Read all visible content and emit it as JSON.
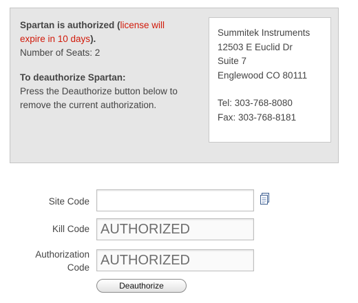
{
  "status": {
    "authorized_text": "Spartan is authorized (",
    "warning_text": "license will expire in 10 days",
    "closing_text": ").",
    "seats_text": "Number of Seats: 2",
    "deauth_heading": "To deauthorize Spartan:",
    "deauth_instructions": "Press the Deauthorize button below to remove the current authorization."
  },
  "contact": {
    "company": "Summitek Instruments",
    "street": "12503 E Euclid Dr",
    "suite": "Suite 7",
    "city": "Englewood CO 80111",
    "tel": "Tel: 303-768-8080",
    "fax": "Fax: 303-768-8181"
  },
  "form": {
    "site_code_label": "Site Code",
    "site_code_value": "",
    "kill_code_label": "Kill Code",
    "kill_code_value": "AUTHORIZED",
    "auth_code_label": "Authorization Code",
    "auth_code_value": "AUTHORIZED",
    "copy_icon": "copy-document-icon",
    "deauthorize_label": "Deauthorize"
  },
  "colors": {
    "panel_bg": "#e6e6e6",
    "warning": "#d11a0a"
  }
}
